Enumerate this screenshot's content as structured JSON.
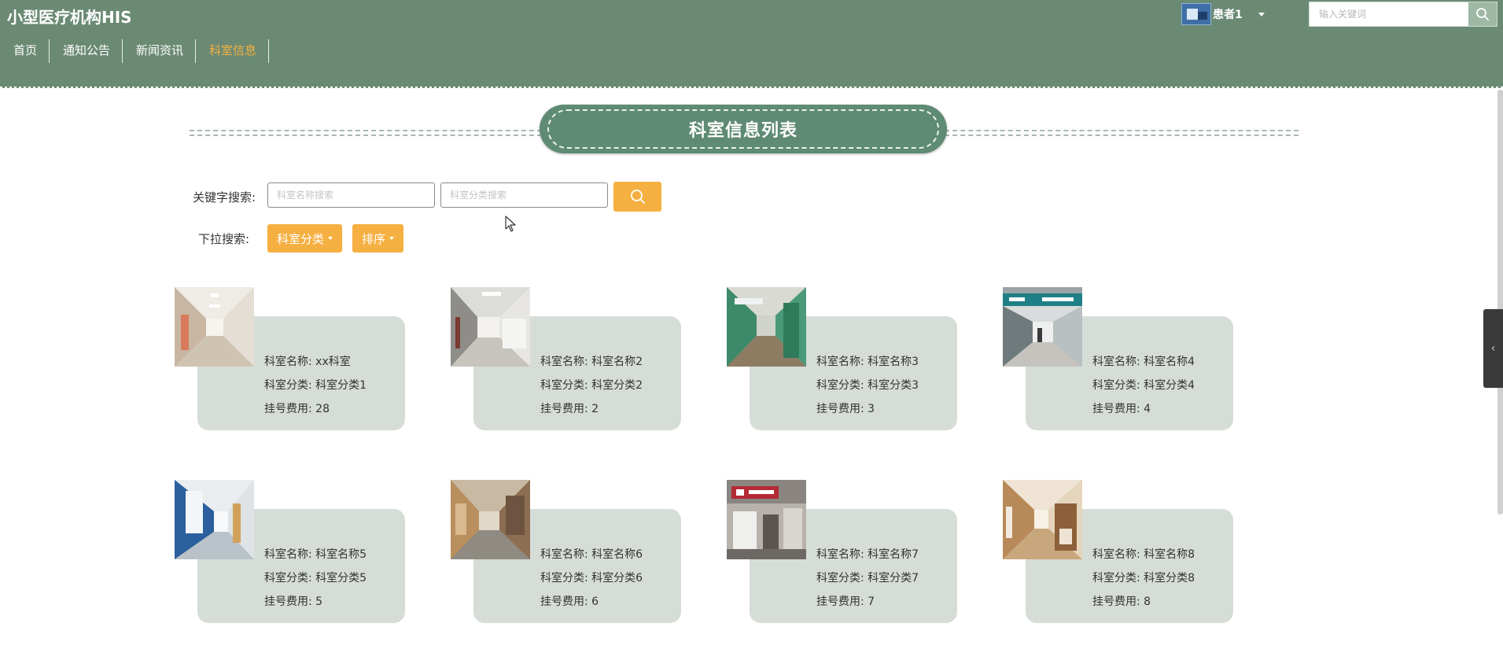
{
  "header": {
    "brand": "小型医疗机构HIS",
    "nav": [
      {
        "label": "首页",
        "active": false
      },
      {
        "label": "通知公告",
        "active": false
      },
      {
        "label": "新闻资讯",
        "active": false
      },
      {
        "label": "科室信息",
        "active": true
      }
    ],
    "user": {
      "name": "患者1",
      "avatar_icon": "user-avatar"
    },
    "search": {
      "placeholder": "输入关键词",
      "icon": "search-icon"
    }
  },
  "page": {
    "title": "科室信息列表"
  },
  "filters": {
    "keyword_label": "关键字搜索:",
    "name_placeholder": "科室名称搜索",
    "category_placeholder": "科室分类搜索",
    "search_icon": "search-icon",
    "dropdown_label": "下拉搜索:",
    "category_dropdown": "科室分类",
    "sort_dropdown": "排序"
  },
  "labels": {
    "name": "科室名称:",
    "category": "科室分类:",
    "fee": "挂号费用:"
  },
  "departments": [
    {
      "name": "xx科室",
      "category": "科室分类1",
      "fee": "28"
    },
    {
      "name": "科室名称2",
      "category": "科室分类2",
      "fee": "2"
    },
    {
      "name": "科室名称3",
      "category": "科室分类3",
      "fee": "3"
    },
    {
      "name": "科室名称4",
      "category": "科室分类4",
      "fee": "4"
    },
    {
      "name": "科室名称5",
      "category": "科室分类5",
      "fee": "5"
    },
    {
      "name": "科室名称6",
      "category": "科室分类6",
      "fee": "6"
    },
    {
      "name": "科室名称7",
      "category": "科室分类7",
      "fee": "7"
    },
    {
      "name": "科室名称8",
      "category": "科室分类8",
      "fee": "8"
    }
  ],
  "colors": {
    "header_bg": "#6b8a74",
    "accent": "#f5b041",
    "card_bg": "#d6ddd7",
    "title_bg": "#5f8a74"
  }
}
